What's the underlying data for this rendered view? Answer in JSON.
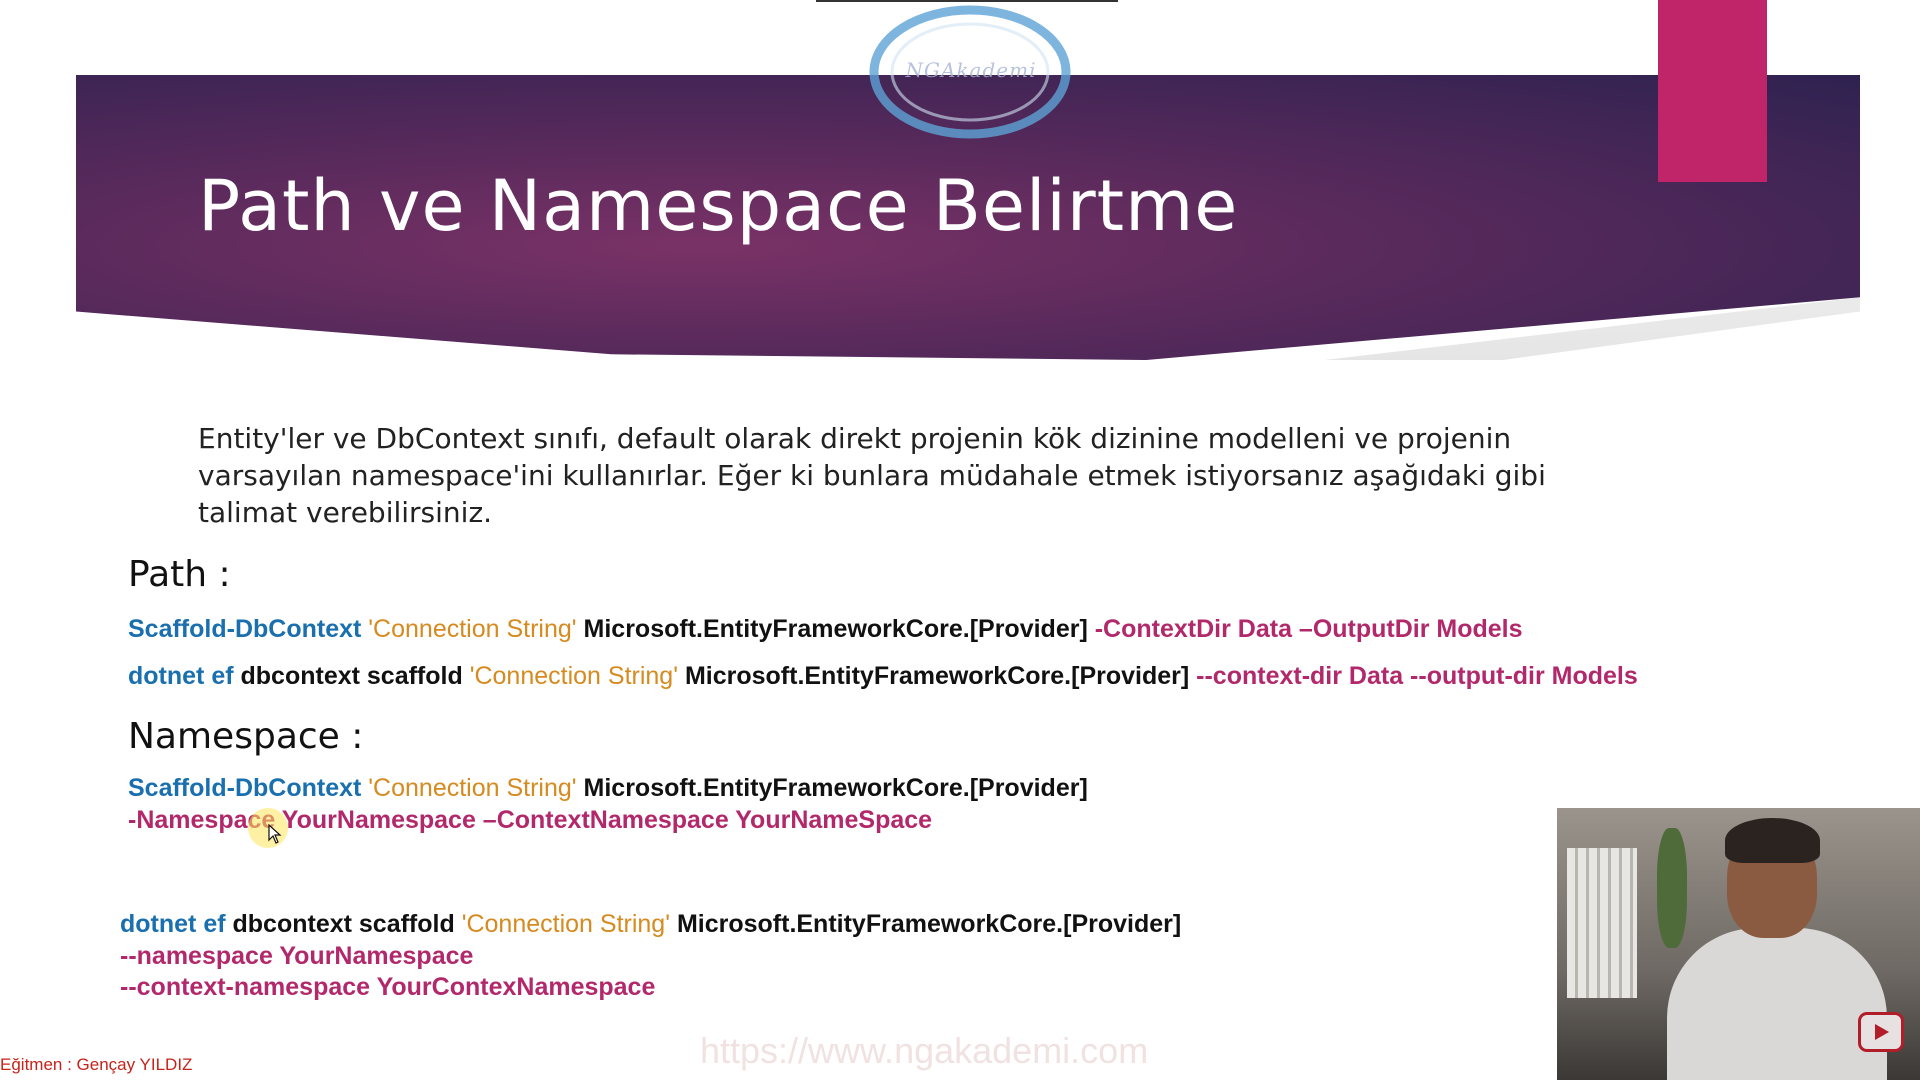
{
  "slide": {
    "title": "Path ve Namespace Belirtme",
    "intro": "Entity'ler ve DbContext sınıfı, default olarak direkt projenin kök dizinine modelleni ve projenin varsayılan namespace'ini kullanırlar. Eğer ki bunlara müdahale etmek istiyorsanız aşağıdaki gibi talimat verebilirsiniz.",
    "path_heading": "Path :",
    "namespace_heading": "Namespace :"
  },
  "path_commands": {
    "line1": {
      "cmd": "Scaffold-DbContext",
      "conn": "'Connection String'",
      "provider": "Microsoft.EntityFrameworkCore.[Provider]",
      "opts": "-ContextDir Data –OutputDir Models"
    },
    "line2": {
      "cmd": "dotnet ef",
      "sub": "dbcontext scaffold",
      "conn": "'Connection String'",
      "provider": "Microsoft.EntityFrameworkCore.[Provider]",
      "opts": "--context-dir Data --output-dir Models"
    }
  },
  "namespace_commands": {
    "line1": {
      "cmd": "Scaffold-DbContext",
      "conn": "'Connection String'",
      "provider": "Microsoft.EntityFrameworkCore.[Provider]",
      "opts": "-Namespace YourNamespace –ContextNamespace YourNameSpace"
    },
    "line2": {
      "cmd": "dotnet ef",
      "sub": "dbcontext scaffold",
      "conn": "'Connection String'",
      "provider": "Microsoft.EntityFrameworkCore.[Provider]",
      "opt1": "--namespace YourNamespace",
      "opt2": "--context-namespace YourContexNamespace"
    }
  },
  "overlay": {
    "instructor": "Eğitmen : Gençay YILDIZ",
    "watermark": "https://www.ngakademi.com",
    "logo_text": "NGAkademi",
    "youtube_icon": "youtube-play-icon"
  },
  "colors": {
    "keyword": "#1a6fae",
    "string": "#d68a1f",
    "option": "#b2296b",
    "accent_tab": "#c0256a",
    "banner": "#5a2a5c"
  }
}
